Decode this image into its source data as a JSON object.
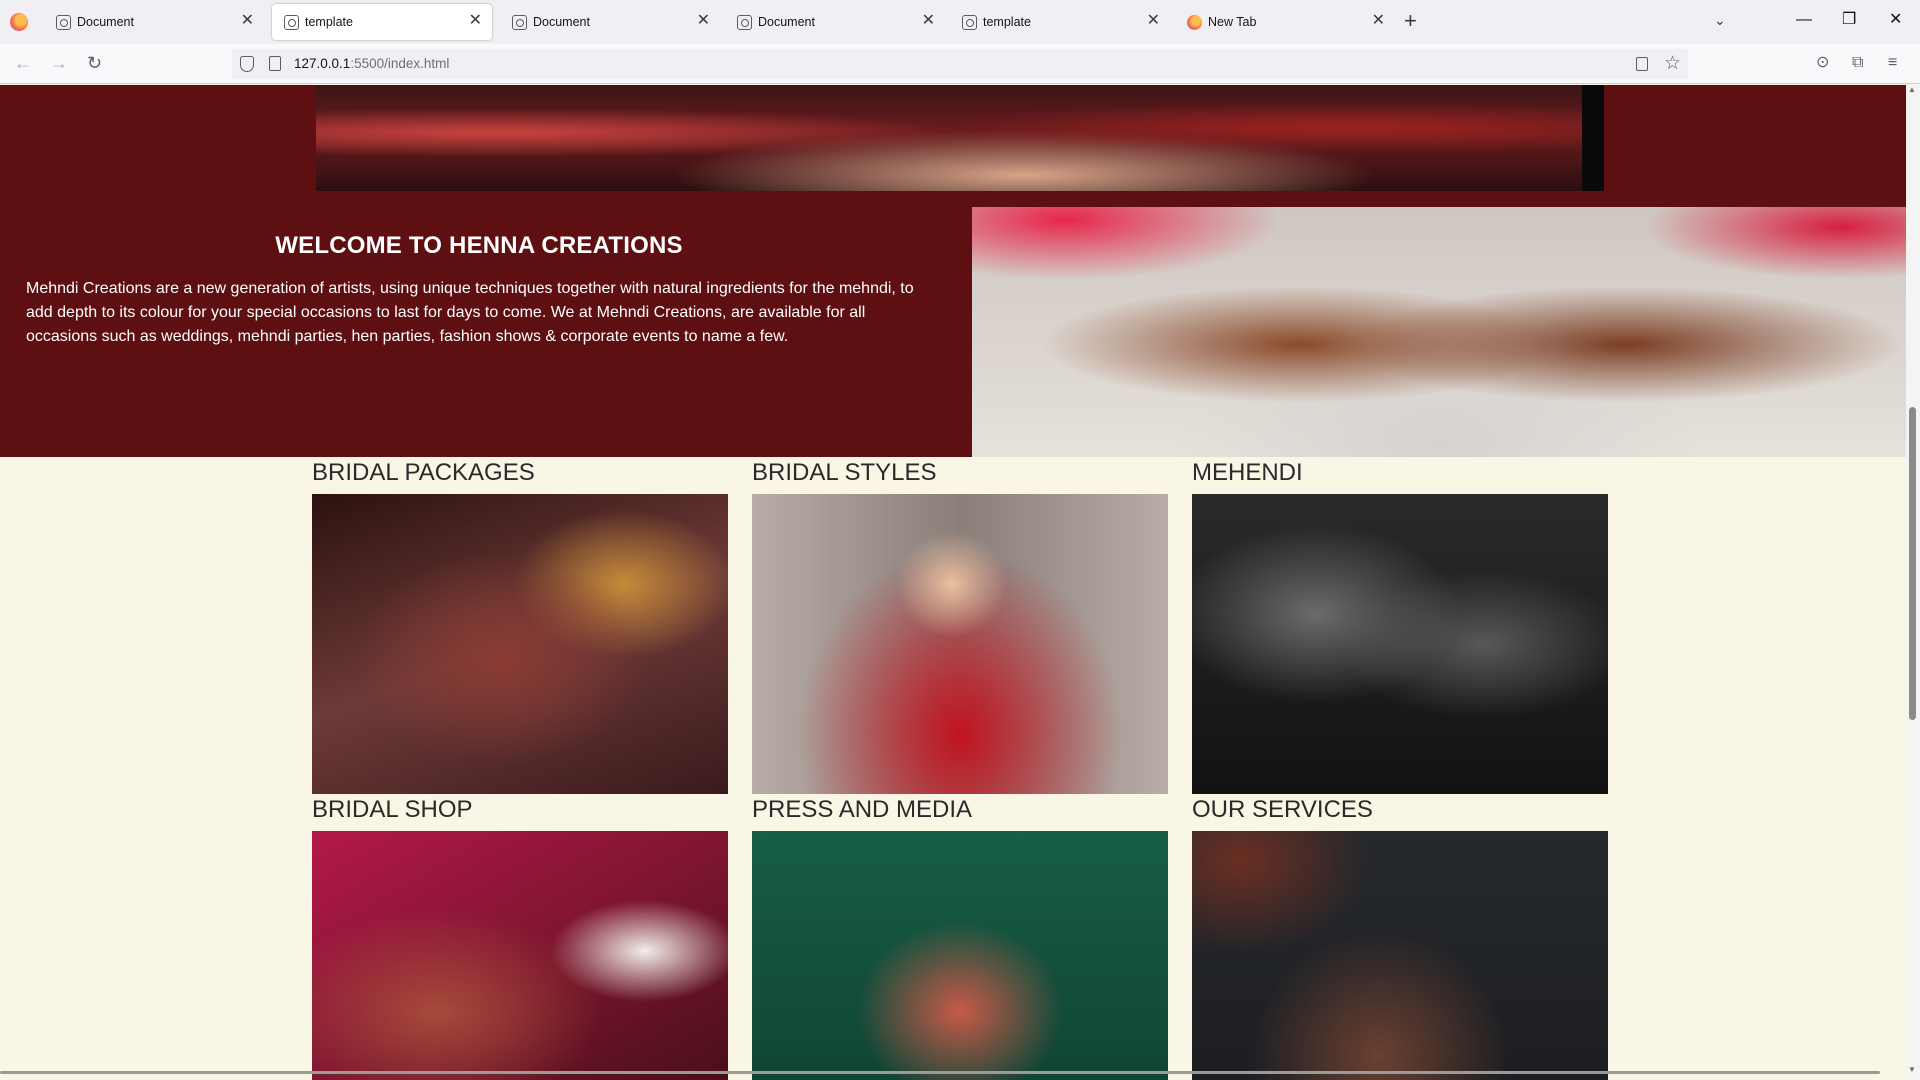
{
  "browser": {
    "tabs": [
      {
        "title": "Document",
        "icon": "generic-page-icon",
        "active": false
      },
      {
        "title": "template",
        "icon": "generic-page-icon",
        "active": true
      },
      {
        "title": "Document",
        "icon": "generic-page-icon",
        "active": false
      },
      {
        "title": "Document",
        "icon": "generic-page-icon",
        "active": false
      },
      {
        "title": "template",
        "icon": "generic-page-icon",
        "active": false
      },
      {
        "title": "New Tab",
        "icon": "firefox-icon",
        "active": false
      }
    ],
    "tab_close": "✕",
    "new_tab": "+",
    "tab_list": "⌄",
    "window": {
      "minimize": "—",
      "restore": "❐",
      "close": "✕"
    },
    "nav": {
      "back": "←",
      "forward": "→",
      "reload": "↻"
    },
    "url": {
      "host": "127.0.0.1",
      "path": ":5500/index.html"
    },
    "toolbar": {
      "star": "☆",
      "pocket": "⊙",
      "extensions": "⧉",
      "menu": "≡"
    }
  },
  "page": {
    "intro": {
      "title": "WELCOME TO HENNA CREATIONS",
      "text": "Mehndi Creations are a new generation of artists, using unique techniques together with natural ingredients for the mehndi, to add depth to its colour for your special occasions to last for days to come. We at Mehndi Creations, are available for all occasions such as weddings, mehndi parties, hen parties, fashion shows & corporate events to name a few."
    },
    "cards": [
      {
        "title": "BRIDAL PACKAGES"
      },
      {
        "title": "BRIDAL STYLES"
      },
      {
        "title": "MEHENDI"
      },
      {
        "title": "BRIDAL SHOP"
      },
      {
        "title": "PRESS AND MEDIA"
      },
      {
        "title": "OUR SERVICES"
      }
    ]
  },
  "colors": {
    "maroon": "#5e0f12",
    "cream": "#f9f6e6"
  },
  "scrollbar": {
    "up": "▲",
    "down": "▼"
  }
}
